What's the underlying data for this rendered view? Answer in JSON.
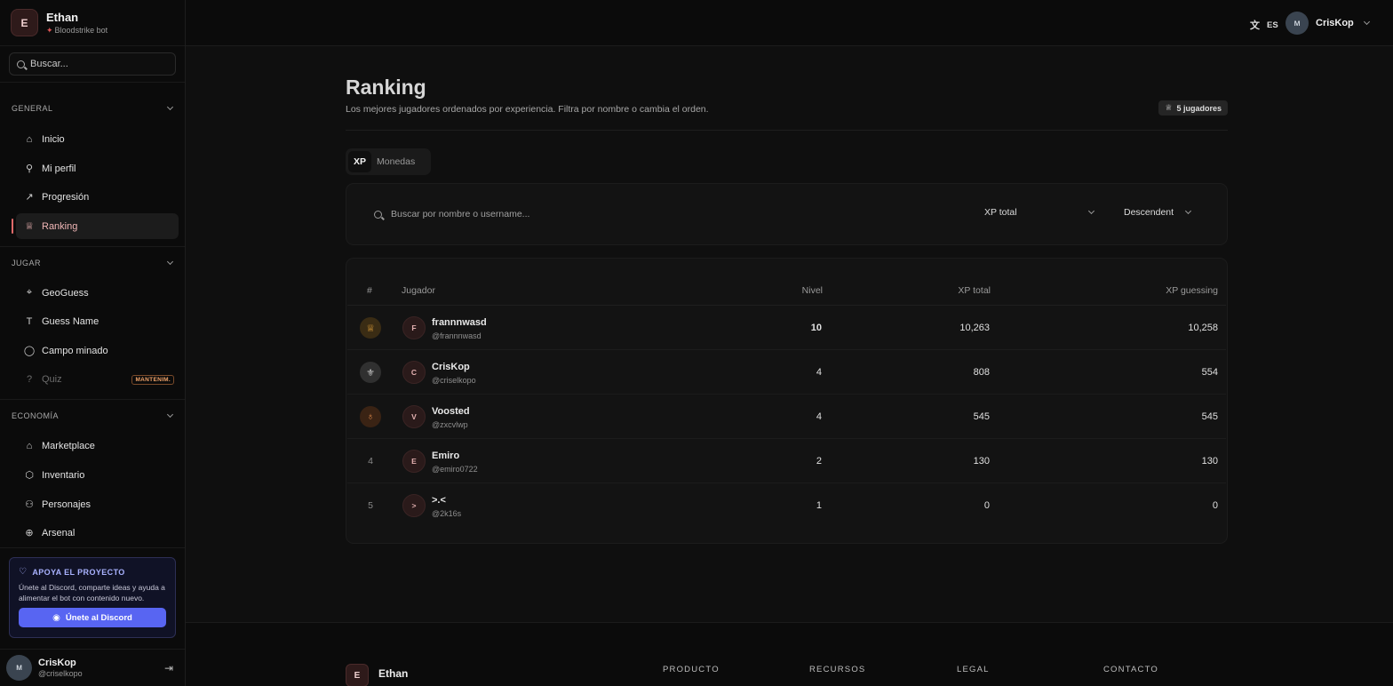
{
  "brand": {
    "initial": "E",
    "name": "Ethan",
    "subtitle": "Bloodstrike bot"
  },
  "sidebar": {
    "search_placeholder": "Buscar...",
    "sections": {
      "general": {
        "title": "GENERAL",
        "items": [
          {
            "label": "Inicio",
            "icon": "home-icon"
          },
          {
            "label": "Mi perfil",
            "icon": "user-icon"
          },
          {
            "label": "Progresión",
            "icon": "trend-icon"
          },
          {
            "label": "Ranking",
            "icon": "trophy-icon"
          }
        ]
      },
      "jugar": {
        "title": "JUGAR",
        "items": [
          {
            "label": "GeoGuess",
            "icon": "crosshair-icon"
          },
          {
            "label": "Guess Name",
            "icon": "type-icon"
          },
          {
            "label": "Campo minado",
            "icon": "bomb-icon"
          },
          {
            "label": "Quiz",
            "icon": "help-icon",
            "badge": "MANTENIM."
          }
        ]
      },
      "economia": {
        "title": "ECONOMÍA",
        "items": [
          {
            "label": "Marketplace",
            "icon": "store-icon"
          },
          {
            "label": "Inventario",
            "icon": "package-icon"
          },
          {
            "label": "Personajes",
            "icon": "users-icon"
          },
          {
            "label": "Arsenal",
            "icon": "target-icon"
          }
        ]
      }
    },
    "support": {
      "title": "APOYA EL PROYECTO",
      "text": "Únete al Discord, comparte ideas y ayuda a alimentar el bot con contenido nuevo.",
      "button": "Únete al Discord"
    },
    "user": {
      "name": "CrisKop",
      "handle": "@criselkopo"
    }
  },
  "topbar": {
    "lang": "ES",
    "user": "CrisKop"
  },
  "page": {
    "title": "Ranking",
    "subtitle": "Los mejores jugadores ordenados por experiencia. Filtra por nombre o cambia el orden.",
    "count_badge": "5 jugadores",
    "tabs": [
      "XP",
      "Monedas"
    ],
    "search_placeholder": "Buscar por nombre o username...",
    "sort_field": "XP total",
    "sort_order": "Descendent"
  },
  "table": {
    "headers": {
      "rank": "#",
      "player": "Jugador",
      "level": "Nivel",
      "xp_total": "XP total",
      "xp_guessing": "XP guessing"
    },
    "rows": [
      {
        "rank": "1",
        "initial": "F",
        "name": "frannnwasd",
        "handle": "@frannnwasd",
        "level": "10",
        "xp_total": "10,263",
        "xp_guessing": "10,258"
      },
      {
        "rank": "2",
        "initial": "C",
        "name": "CrisKop",
        "handle": "@criselkopo",
        "level": "4",
        "xp_total": "808",
        "xp_guessing": "554"
      },
      {
        "rank": "3",
        "initial": "V",
        "name": "Voosted",
        "handle": "@zxcvlwp",
        "level": "4",
        "xp_total": "545",
        "xp_guessing": "545"
      },
      {
        "rank": "4",
        "initial": "E",
        "name": "Emiro",
        "handle": "@emiro0722",
        "level": "2",
        "xp_total": "130",
        "xp_guessing": "130"
      },
      {
        "rank": "5",
        "initial": ">",
        "name": ">.<",
        "handle": "@2k16s",
        "level": "1",
        "xp_total": "0",
        "xp_guessing": "0"
      }
    ]
  },
  "footer": {
    "brand_initial": "E",
    "brand_name": "Ethan",
    "columns": [
      "PRODUCTO",
      "RECURSOS",
      "LEGAL",
      "CONTACTO"
    ]
  }
}
